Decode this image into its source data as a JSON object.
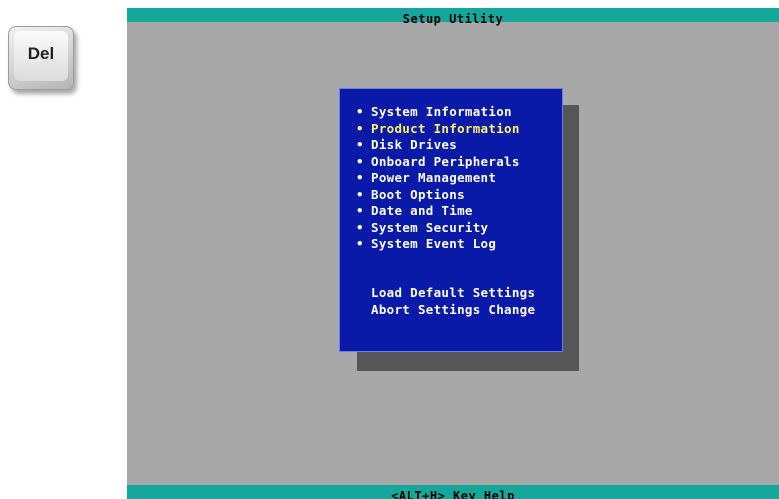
{
  "del_key": {
    "label": "Del",
    "icon": "keyboard-key-icon"
  },
  "bios": {
    "title": "Setup Utility",
    "bottom_help": "<ALT+H>  Key Help",
    "colors": {
      "bar": "#14a89c",
      "background": "#a8a8a8",
      "panel": "#0a1aa8",
      "panel_shadow": "#565656",
      "text": "#ffffff",
      "selected_text": "#fff36a"
    },
    "menu": {
      "bullet": "•",
      "items": [
        {
          "label": "System Information"
        },
        {
          "label": "Product Information",
          "selected": true
        },
        {
          "label": "Disk Drives"
        },
        {
          "label": "Onboard Peripherals"
        },
        {
          "label": "Power Management"
        },
        {
          "label": "Boot Options"
        },
        {
          "label": "Date and Time"
        },
        {
          "label": "System Security"
        },
        {
          "label": "System Event Log"
        }
      ],
      "actions": [
        {
          "label": "Load Default Settings"
        },
        {
          "label": "Abort Settings Change"
        }
      ]
    }
  }
}
